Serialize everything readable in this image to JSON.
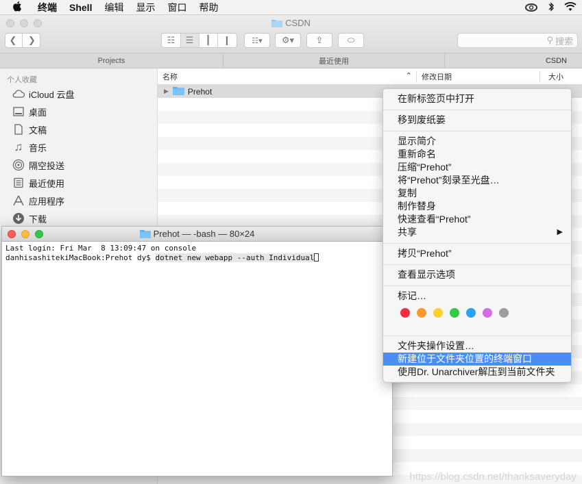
{
  "menubar": {
    "items": [
      "终端",
      "Shell",
      "编辑",
      "显示",
      "窗口",
      "帮助"
    ]
  },
  "finder": {
    "title": "CSDN",
    "search_placeholder": "搜索",
    "tabs": [
      "Projects",
      "最近使用",
      "CSDN"
    ],
    "sidebar": {
      "section": "个人收藏",
      "items": [
        {
          "label": "iCloud 云盘",
          "icon": "cloud-icon"
        },
        {
          "label": "桌面",
          "icon": "desktop-icon"
        },
        {
          "label": "文稿",
          "icon": "document-icon"
        },
        {
          "label": "音乐",
          "icon": "music-icon"
        },
        {
          "label": "隔空投送",
          "icon": "airdrop-icon"
        },
        {
          "label": "最近使用",
          "icon": "recents-icon"
        },
        {
          "label": "应用程序",
          "icon": "applications-icon"
        },
        {
          "label": "下载",
          "icon": "download-icon"
        }
      ]
    },
    "columns": {
      "name": "名称",
      "modified": "修改日期",
      "size": "大小"
    },
    "rows": [
      {
        "name": "Prehot"
      }
    ]
  },
  "terminal": {
    "title": "Prehot — -bash — 80×24",
    "line1": "Last login: Fri Mar  8 13:09:47 on console",
    "prompt": "danhisashitekiMacBook:Prehot dy$ ",
    "command": "dotnet new webapp --auth Individual"
  },
  "context_menu": {
    "groups": [
      [
        "在新标签页中打开"
      ],
      [
        "移到废纸篓"
      ],
      [
        "显示简介",
        "重新命名",
        "压缩“Prehot”",
        "将“Prehot”刻录至光盘…",
        "复制",
        "制作替身",
        "快速查看“Prehot”",
        "共享"
      ],
      [
        "拷贝“Prehot”"
      ],
      [
        "查看显示选项"
      ],
      [
        "标记…"
      ]
    ],
    "tag_colors": [
      "#fb2c41",
      "#fb9a2a",
      "#fdd02e",
      "#36c944",
      "#2aa2f7",
      "#d56ce2",
      "#9d9d9d"
    ],
    "services": [
      "文件夹操作设置…",
      "新建位于文件夹位置的终端窗口",
      "使用Dr. Unarchiver解压到当前文件夹"
    ],
    "highlight_color": "#4a8ef5"
  },
  "watermark": "https://blog.csdn.net/thanksaveryday"
}
